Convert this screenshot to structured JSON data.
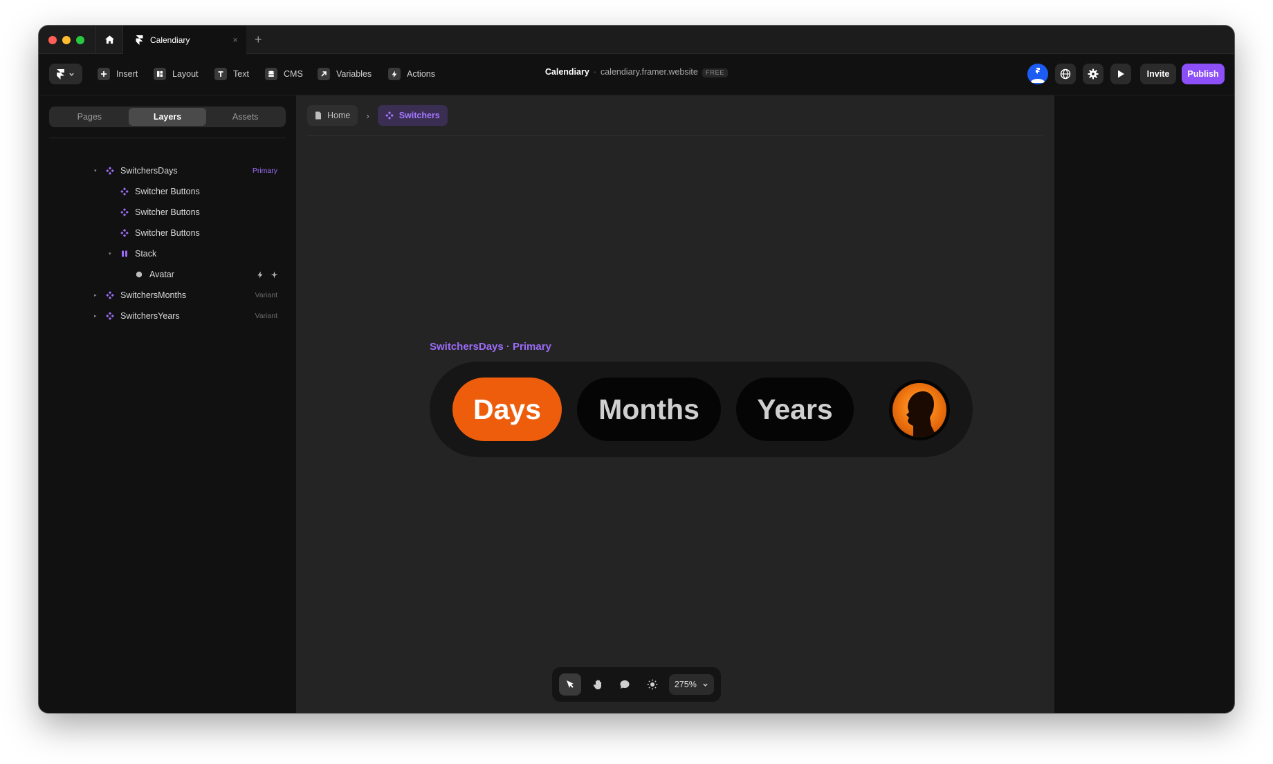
{
  "tabbar": {
    "doc_tab_title": "Calendiary",
    "close_glyph": "×",
    "new_tab_glyph": "+"
  },
  "toolbar": {
    "tools": [
      {
        "label": "Insert",
        "icon": "plus-icon"
      },
      {
        "label": "Layout",
        "icon": "layout-icon"
      },
      {
        "label": "Text",
        "icon": "text-icon"
      },
      {
        "label": "CMS",
        "icon": "database-icon"
      },
      {
        "label": "Variables",
        "icon": "arrow-up-right-icon"
      },
      {
        "label": "Actions",
        "icon": "lightning-icon"
      }
    ],
    "project_name": "Calendiary",
    "separator": "·",
    "project_url": "calendiary.framer.website",
    "plan_badge": "FREE",
    "invite_label": "Invite",
    "publish_label": "Publish"
  },
  "left_panel": {
    "tabs": [
      {
        "label": "Pages",
        "active": false
      },
      {
        "label": "Layers",
        "active": true
      },
      {
        "label": "Assets",
        "active": false
      }
    ],
    "layers": [
      {
        "name": "SwitchersDays",
        "tag": "Primary",
        "caret": "▾",
        "icon": "component-icon"
      },
      {
        "name": "Switcher Buttons",
        "icon": "component-icon"
      },
      {
        "name": "Switcher Buttons",
        "icon": "component-icon"
      },
      {
        "name": "Switcher Buttons",
        "icon": "component-icon"
      },
      {
        "name": "Stack",
        "caret": "▾",
        "icon": "stack-icon"
      },
      {
        "name": "Avatar",
        "icon": "dot-icon"
      },
      {
        "name": "SwitchersMonths",
        "tag": "Variant",
        "caret": "▸",
        "icon": "component-icon"
      },
      {
        "name": "SwitchersYears",
        "tag": "Variant",
        "caret": "▸",
        "icon": "component-icon"
      }
    ]
  },
  "canvas": {
    "breadcrumb": {
      "home": "Home",
      "separator": "›",
      "current": "Switchers"
    },
    "component_label": "SwitchersDays · Primary",
    "switcher_buttons": [
      "Days",
      "Months",
      "Years"
    ],
    "active_button": "Days",
    "zoom_level": "275%"
  },
  "colors": {
    "accent_purple": "#8d4ff7",
    "active_pill": "#ee5d0c",
    "canvas_bg": "#242424",
    "panel_bg": "#111111"
  }
}
